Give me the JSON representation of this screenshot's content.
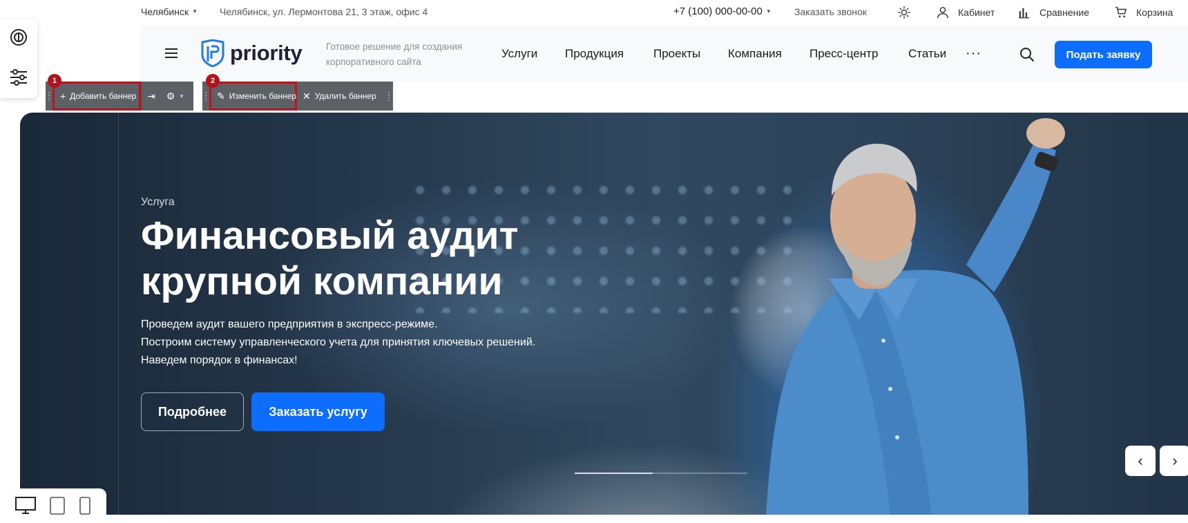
{
  "topbar": {
    "city": "Челябинск",
    "address": "Челябинск, ул. Лермонтова 21, 3 этаж, офис 4",
    "phone": "+7 (100) 000-00-00",
    "callback": "Заказать звонок",
    "cabinet": "Кабинет",
    "compare": "Сравнение",
    "cart": "Корзина"
  },
  "header": {
    "logo_text": "priority",
    "tagline": "Готовое решение для создания корпоративного сайта",
    "nav": [
      "Услуги",
      "Продукция",
      "Проекты",
      "Компания",
      "Пресс-центр",
      "Статьи"
    ],
    "more": "···",
    "cta": "Подать заявку"
  },
  "admin": {
    "add_banner": "Добавить баннер",
    "edit_banner": "Изменить баннер",
    "delete_banner": "Удалить баннер",
    "badge_1": "1",
    "badge_2": "2"
  },
  "banner": {
    "tag": "Услуга",
    "title": "Финансовый аудит крупной компании",
    "desc_lines": [
      "Проведем аудит вашего предприятия в экспресс-режиме.",
      "Построим систему управленческого учета для принятия ключевых решений.",
      "Наведем порядок в финансах!"
    ],
    "btn_more": "Подробнее",
    "btn_order": "Заказать услугу",
    "slider_progress": 0.45
  },
  "colors": {
    "accent": "#0d6efd",
    "admin_bar": "#5d6166",
    "highlight": "#c1121f"
  },
  "icons": [
    "search-icon",
    "user-icon",
    "chart-icon",
    "cart-icon",
    "sun-icon",
    "menu-icon",
    "pencil-icon",
    "plus-icon",
    "close-icon",
    "gear-icon",
    "desktop-icon",
    "tablet-icon",
    "mobile-icon"
  ]
}
